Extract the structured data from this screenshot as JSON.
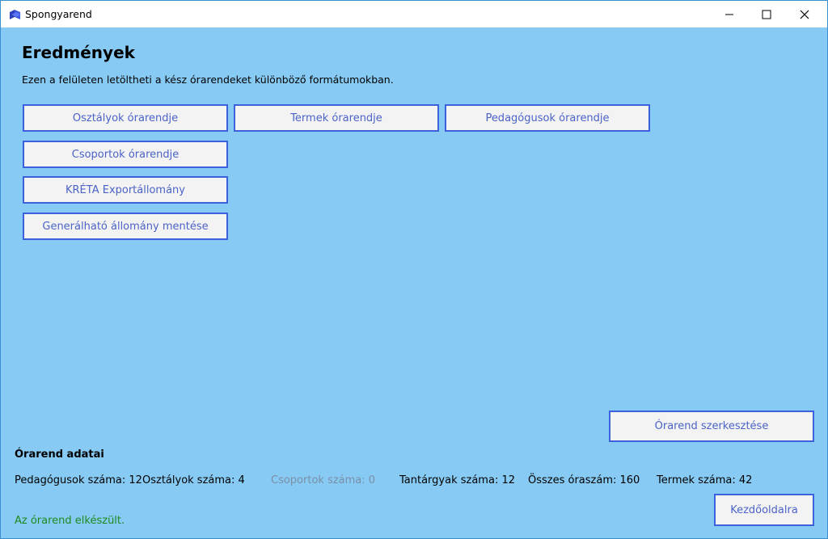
{
  "window": {
    "title": "Spongyarend"
  },
  "page": {
    "heading": "Eredmények",
    "subtitle": "Ezen a felületen letöltheti a kész órarendeket különböző formátumokban."
  },
  "buttons": {
    "osztalyok": "Osztályok órarendje",
    "termek": "Termek órarendje",
    "pedagogusok": "Pedagógusok órarendje",
    "csoportok": "Csoportok órarendje",
    "kreta": "KRÉTA Exportállomány",
    "generalhato": "Generálható állomány mentése",
    "szerkesztes": "Órarend szerkesztése",
    "kezdooldal": "Kezdőoldalra"
  },
  "stats": {
    "title": "Órarend adatai",
    "items": [
      "Pedagógusok száma: 12",
      "Osztályok száma: 4",
      "Csoportok száma: 0",
      "Tantárgyak száma: 12",
      "Összes óraszám: 160",
      "Termek száma: 42"
    ]
  },
  "status": "Az órarend elkészült.",
  "colors": {
    "background": "#87cbf5",
    "button_border": "#3c61dc",
    "button_text": "#4b63c8",
    "status_text": "#1f8a1f"
  },
  "icons": {
    "app": "cube-app-icon",
    "minimize": "minimize-icon",
    "maximize": "maximize-icon",
    "close": "close-icon"
  }
}
